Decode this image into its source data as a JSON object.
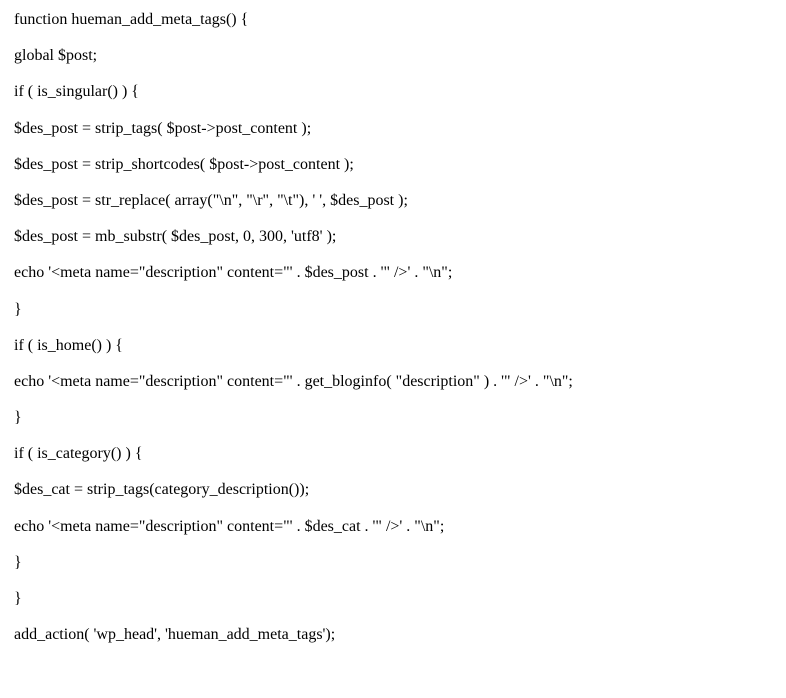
{
  "code": {
    "lines": [
      "function hueman_add_meta_tags() {",
      "global $post;",
      "if ( is_singular() ) {",
      "$des_post = strip_tags( $post->post_content );",
      "$des_post = strip_shortcodes( $post->post_content );",
      "$des_post = str_replace( array(\"\\n\", \"\\r\", \"\\t\"), ' ', $des_post );",
      "$des_post = mb_substr( $des_post, 0, 300, 'utf8' );",
      "echo '<meta name=\"description\" content=\"' . $des_post . '\" />' . \"\\n\";",
      "}",
      "if ( is_home() ) {",
      "echo '<meta name=\"description\" content=\"' . get_bloginfo( \"description\" ) . '\" />' . \"\\n\";",
      "}",
      "if ( is_category() ) {",
      "$des_cat = strip_tags(category_description());",
      "echo '<meta name=\"description\" content=\"' . $des_cat . '\" />' . \"\\n\";",
      "}",
      "}",
      "add_action( 'wp_head', 'hueman_add_meta_tags');"
    ]
  }
}
